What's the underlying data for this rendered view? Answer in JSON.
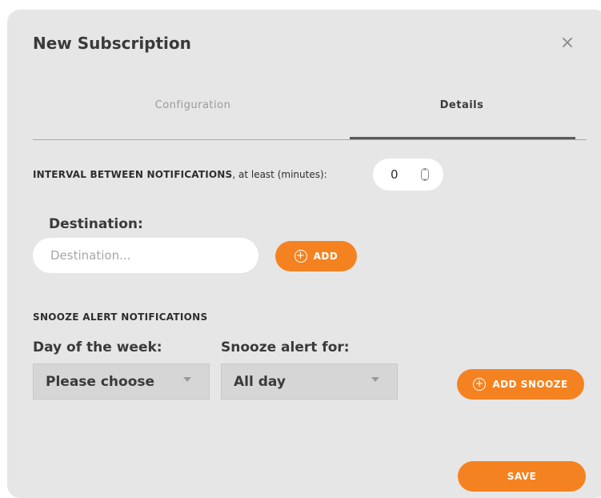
{
  "dialog": {
    "title": "New Subscription",
    "close_icon": "close-icon"
  },
  "tabs": [
    {
      "label": "Configuration",
      "active": false
    },
    {
      "label": "Details",
      "active": true
    }
  ],
  "interval": {
    "label_bold": "INTERVAL BETWEEN NOTIFICATIONS",
    "label_rest": ", at least (minutes):",
    "value": "0"
  },
  "destination": {
    "label": "Destination:",
    "placeholder": "Destination...",
    "value": "",
    "add_label": "ADD"
  },
  "snooze": {
    "heading": "SNOOZE ALERT NOTIFICATIONS",
    "day_label": "Day of the week:",
    "day_value": "Please choose",
    "for_label": "Snooze alert for:",
    "for_value": "All day",
    "add_label": "ADD SNOOZE"
  },
  "footer": {
    "save_label": "SAVE"
  },
  "colors": {
    "accent": "#f58220",
    "modal_bg": "#e6e6e6"
  }
}
